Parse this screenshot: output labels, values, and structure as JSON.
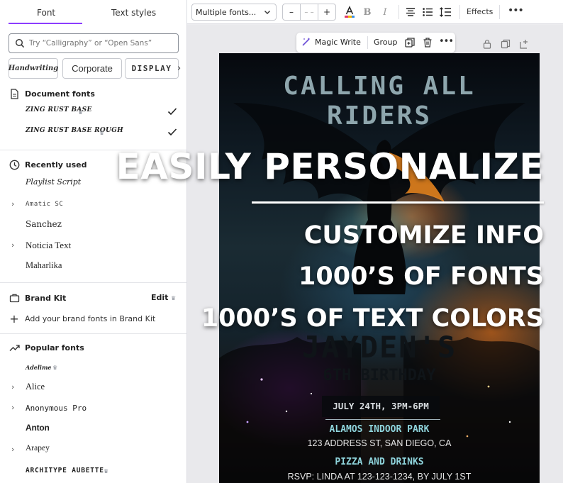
{
  "panel": {
    "tabs": {
      "font": "Font",
      "text_styles": "Text styles"
    },
    "search": {
      "placeholder": "Try “Calligraphy” or “Open Sans”"
    },
    "chips": {
      "handwriting": "Handwriting",
      "corporate": "Corporate",
      "display": "DISPLAY"
    },
    "document_fonts": {
      "title": "Document fonts",
      "items": [
        {
          "label": "ZING RUST BASE",
          "checked": true
        },
        {
          "label": "ZING RUST BASE ROUGH",
          "checked": true
        }
      ]
    },
    "recently_used": {
      "title": "Recently used",
      "items": [
        "Playlist Script",
        "Amatic SC",
        "Sanchez",
        "Noticia Text",
        "Maharlika"
      ]
    },
    "brand_kit": {
      "title": "Brand Kit",
      "edit": "Edit",
      "add": "Add your brand fonts in Brand Kit"
    },
    "popular": {
      "title": "Popular fonts",
      "items": [
        "Adelime",
        "Alice",
        "Anonymous Pro",
        "Anton",
        "Arapey",
        "ARCHITYPE AUBETTE"
      ]
    }
  },
  "toolbar": {
    "font_select": "Multiple fonts...",
    "size_minus": "–",
    "size_value": "– –",
    "size_plus": "+",
    "effects": "Effects"
  },
  "float_bar": {
    "magic_write": "Magic Write",
    "group": "Group"
  },
  "poster": {
    "title_line1": "CALLING ALL",
    "title_line2": "RIDERS",
    "name": "JAYDEN'S",
    "occasion": "6TH BIRTHDAY",
    "date": "JULY 24TH, 3PM-6PM",
    "venue": "ALAMOS INDOOR PARK",
    "address": "123 ADDRESS ST, SAN DIEGO, CA",
    "food": "PIZZA AND DRINKS",
    "rsvp": "RSVP: LINDA AT 123-123-1234, BY JULY 1ST"
  },
  "overlay": {
    "headline": "EASILY PERSONALIZE",
    "line1": "CUSTOMIZE INFO",
    "line2": "1000’S OF FONTS",
    "line3": "1000’S OF TEXT COLORS"
  },
  "colors": {
    "accent": "#8b3dff",
    "overlay_text": "#ffffff",
    "poster_teal": "#8fd4dc"
  }
}
